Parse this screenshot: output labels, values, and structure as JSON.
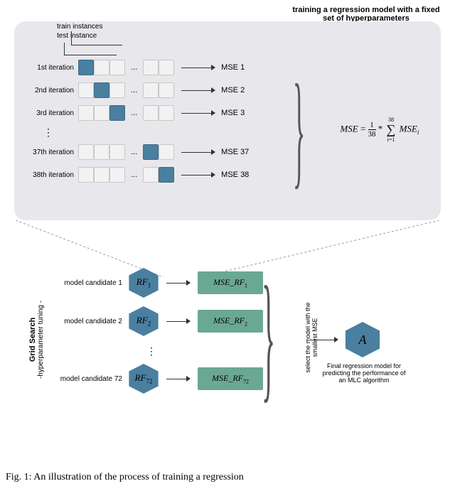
{
  "top": {
    "title": "training a regression model with a fixed set of hyperparameters",
    "legend": {
      "train": "train instances",
      "test": "test instance"
    },
    "iterations": [
      {
        "label": "1st iteration",
        "mse": "MSE 1",
        "highlight": 0
      },
      {
        "label": "2nd iteration",
        "mse": "MSE 2",
        "highlight": 1
      },
      {
        "label": "3rd iteration",
        "mse": "MSE 3",
        "highlight": 2
      },
      {
        "label": "37th iteration",
        "mse": "MSE 37",
        "highlight": 3
      },
      {
        "label": "38th iteration",
        "mse": "MSE 38",
        "highlight": 4
      }
    ],
    "mse_equation": {
      "lhs": "MSE",
      "eq": "=",
      "star": "*",
      "frac_num": "1",
      "frac_den": "38",
      "sum_ub": "38",
      "sum_lb": "i=1",
      "term": "MSE",
      "term_sub": "i"
    }
  },
  "bottom": {
    "grid_search_title": "Grid Search",
    "grid_search_sub": "-hyperparameter tuning -",
    "candidates": [
      {
        "label": "model candidate 1",
        "hex": "RF",
        "hex_sub": "1",
        "mse": "MSE_RF",
        "mse_sub": "1"
      },
      {
        "label": "model candidate 2",
        "hex": "RF",
        "hex_sub": "2",
        "mse": "MSE_RF",
        "mse_sub": "2"
      },
      {
        "label": "model candidate 72",
        "hex": "RF",
        "hex_sub": "72",
        "mse": "MSE_RF",
        "mse_sub": "72"
      }
    ],
    "select_label": "select the model with the smallest MSE",
    "final_hex": "A",
    "final_caption": "Final regression model for predicting the performance of an MLC algorithm"
  },
  "caption": "Fig. 1: An illustration of the process of training a regression"
}
